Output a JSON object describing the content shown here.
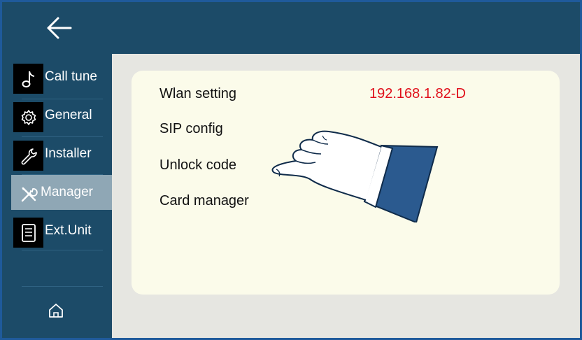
{
  "header": {
    "back_icon": "arrow-left-icon"
  },
  "sidebar": {
    "items": [
      {
        "label": "Call tune",
        "icon": "music-note-icon"
      },
      {
        "label": "General",
        "icon": "gear-icon"
      },
      {
        "label": "Installer",
        "icon": "wrench-icon"
      },
      {
        "label": "Manager",
        "icon": "tools-icon",
        "active": true
      },
      {
        "label": "Ext.Unit",
        "icon": "document-icon"
      }
    ],
    "home_icon": "home-icon"
  },
  "main": {
    "menu": [
      {
        "label": "Wlan setting",
        "value": "192.168.1.82-D"
      },
      {
        "label": "SIP config"
      },
      {
        "label": "Unlock code"
      },
      {
        "label": "Card manager"
      }
    ]
  },
  "colors": {
    "header_bg": "#1c4b68",
    "active_item_bg": "#8fa7b5",
    "content_bg": "#e6e6e1",
    "card_bg": "#fbfbea",
    "ip_text": "#e0101b"
  }
}
